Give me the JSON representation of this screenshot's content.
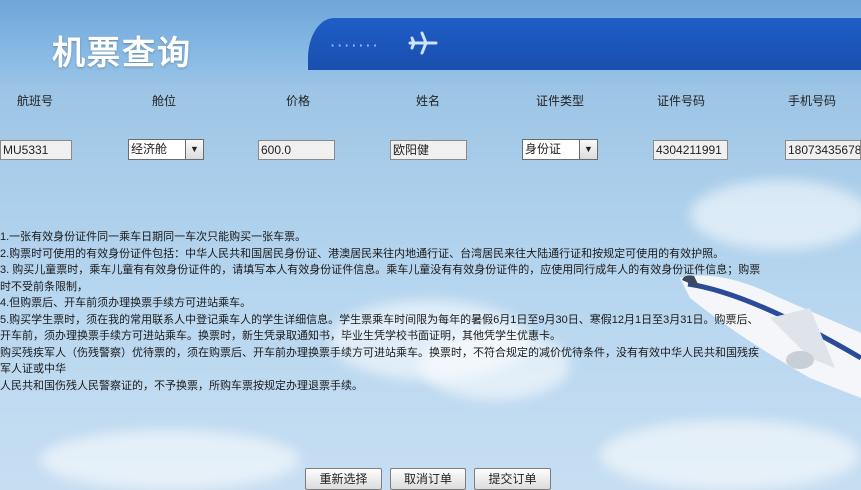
{
  "page": {
    "title": "机票查询"
  },
  "columns": [
    "航班号",
    "舱位",
    "价格",
    "姓名",
    "证件类型",
    "证件号码",
    "手机号码"
  ],
  "row": {
    "flight_no": "MU5331",
    "cabin": "经济舱",
    "price": "600.0",
    "name": "欧阳健",
    "id_type": "身份证",
    "id_no": "4304211991",
    "phone": "18073435678"
  },
  "notes": [
    "1.一张有效身份证件同一乘车日期同一车次只能购买一张车票。",
    "2.购票时可使用的有效身份证件包括：中华人民共和国居民身份证、港澳居民来往内地通行证、台湾居民来往大陆通行证和按规定可使用的有效护照。",
    "3. 购买儿童票时，乘车儿童有有效身份证件的，请填写本人有效身份证件信息。乘车儿童没有有效身份证件的，应使用同行成年人的有效身份证件信息；购票",
    "时不受前条限制，",
    "4.但购票后、开车前须办理换票手续方可进站乘车。",
    "5.购买学生票时，须在我的常用联系人中登记乘车人的学生详细信息。学生票乘车时间限为每年的暑假6月1日至9月30日、寒假12月1日至3月31日。购票后、",
    "开车前，须办理换票手续方可进站乘车。换票时，新生凭录取通知书，毕业生凭学校书面证明，其他凭学生优惠卡。",
    "购买残疾军人（伤残警察）优待票的，须在购票后、开车前办理换票手续方可进站乘车。换票时，不符合规定的减价优待条件，没有有效中华人民共和国残疾",
    "军人证或中华",
    "人民共和国伤残人民警察证的，不予换票，所购车票按规定办理退票手续。"
  ],
  "buttons": {
    "reset": "重新选择",
    "cancel": "取消订单",
    "submit": "提交订单"
  },
  "icons": {
    "dropdown": "chevron-down-icon",
    "plane": "airplane-icon"
  }
}
